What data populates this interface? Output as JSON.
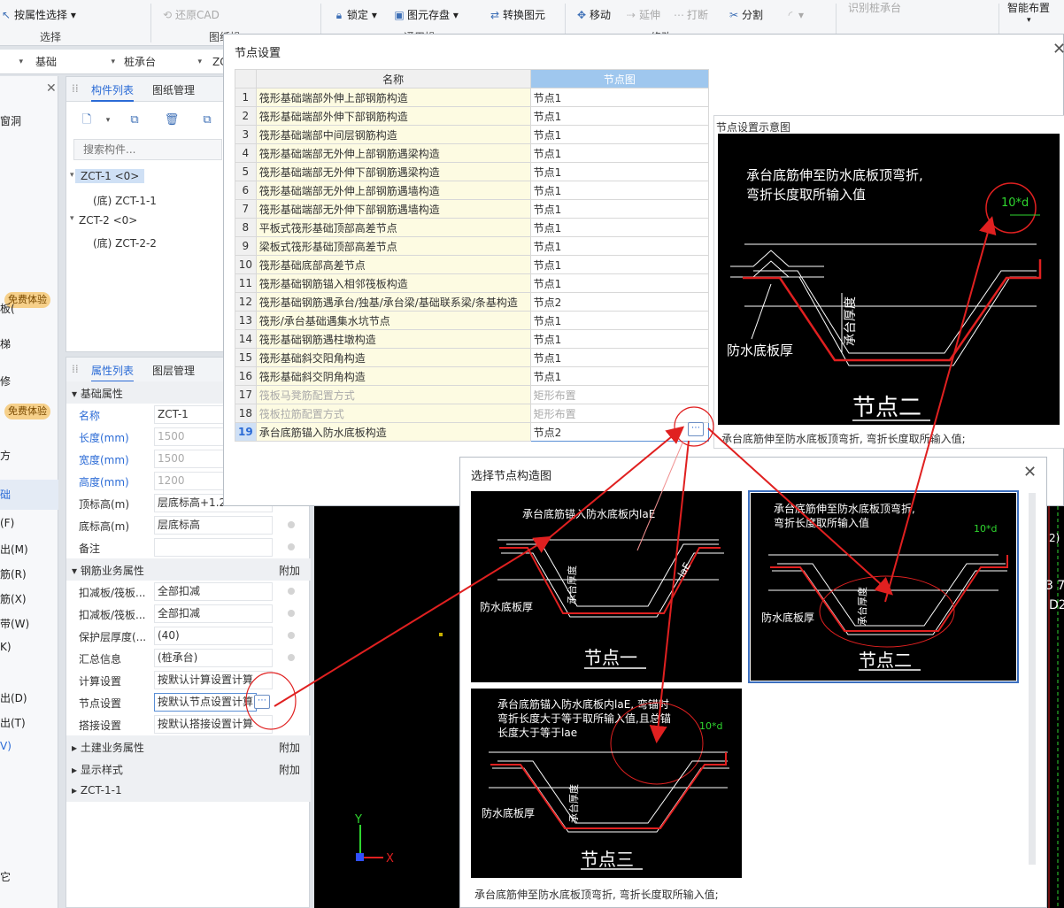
{
  "ribbon": {
    "select_by_attr": "按属性选择",
    "restore_cad": "还原CAD",
    "lock": "锁定",
    "save_element": "图元存盘",
    "convert_element": "转换图元",
    "move": "移动",
    "extend": "延伸",
    "break": "打断",
    "split": "分割",
    "identify_pile_cap": "识别桩承台",
    "smart_layout": "智能布置",
    "group_select": "选择",
    "group_drawing": "图纸操",
    "group_general": "通用操",
    "group_modify": "修改"
  },
  "selectors": {
    "floor": "",
    "category": "基础",
    "type": "桩承台",
    "comp": "ZC"
  },
  "left_strip": {
    "items": [
      "窗洞",
      "板(",
      "梯",
      "修",
      "方",
      "础",
      "(F)",
      "出(M)",
      "筋(R)",
      "筋(X)",
      "带(W)",
      "K)",
      "出(D)",
      "出(T)",
      "V)",
      "它"
    ],
    "badge": "免费体验"
  },
  "component_list": {
    "tab_active": "构件列表",
    "tab_other": "图纸管理",
    "search_placeholder": "搜索构件...",
    "tree": [
      "ZCT-1 <0>",
      "(底) ZCT-1-1",
      "ZCT-2 <0>",
      "(底) ZCT-2-2"
    ]
  },
  "property_panel": {
    "tab_active": "属性列表",
    "tab_other": "图层管理",
    "groups": {
      "basic": "基础属性",
      "rebar": "钢筋业务属性",
      "civil": "土建业务属性",
      "display": "显示样式",
      "sub": "ZCT-1-1"
    },
    "extra": "附加",
    "rows": [
      {
        "label": "名称",
        "value": "ZCT-1"
      },
      {
        "label": "长度(mm)",
        "value": "1500"
      },
      {
        "label": "宽度(mm)",
        "value": "1500"
      },
      {
        "label": "高度(mm)",
        "value": "1200"
      },
      {
        "label": "顶标高(m)",
        "value": "层底标高+1.2"
      },
      {
        "label": "底标高(m)",
        "value": "层底标高"
      },
      {
        "label": "备注",
        "value": ""
      },
      {
        "label": "扣减板/筏板...",
        "value": "全部扣减"
      },
      {
        "label": "扣减板/筏板...",
        "value": "全部扣减"
      },
      {
        "label": "保护层厚度(...",
        "value": "(40)"
      },
      {
        "label": "汇总信息",
        "value": "(桩承台)"
      },
      {
        "label": "计算设置",
        "value": "按默认计算设置计算"
      },
      {
        "label": "节点设置",
        "value": "按默认节点设置计算"
      },
      {
        "label": "搭接设置",
        "value": "按默认搭接设置计算"
      }
    ]
  },
  "node_dialog": {
    "title": "节点设置",
    "col_name": "名称",
    "col_node": "节点图",
    "rows": [
      {
        "no": "1",
        "name": "筏形基础端部外伸上部钢筋构造",
        "node": "节点1"
      },
      {
        "no": "2",
        "name": "筏形基础端部外伸下部钢筋构造",
        "node": "节点1"
      },
      {
        "no": "3",
        "name": "筏形基础端部中间层钢筋构造",
        "node": "节点1"
      },
      {
        "no": "4",
        "name": "筏形基础端部无外伸上部钢筋遇梁构造",
        "node": "节点1"
      },
      {
        "no": "5",
        "name": "筏形基础端部无外伸下部钢筋遇梁构造",
        "node": "节点1"
      },
      {
        "no": "6",
        "name": "筏形基础端部无外伸上部钢筋遇墙构造",
        "node": "节点1"
      },
      {
        "no": "7",
        "name": "筏形基础端部无外伸下部钢筋遇墙构造",
        "node": "节点1"
      },
      {
        "no": "8",
        "name": "平板式筏形基础顶部高差节点",
        "node": "节点1"
      },
      {
        "no": "9",
        "name": "梁板式筏形基础顶部高差节点",
        "node": "节点1"
      },
      {
        "no": "10",
        "name": "筏形基础底部高差节点",
        "node": "节点1"
      },
      {
        "no": "11",
        "name": "筏形基础钢筋锚入相邻筏板构造",
        "node": "节点1"
      },
      {
        "no": "12",
        "name": "筏形基础钢筋遇承台/独基/承台梁/基础联系梁/条基构造",
        "node": "节点2"
      },
      {
        "no": "13",
        "name": "筏形/承台基础遇集水坑节点",
        "node": "节点1"
      },
      {
        "no": "14",
        "name": "筏形基础钢筋遇柱墩构造",
        "node": "节点1"
      },
      {
        "no": "15",
        "name": "筏形基础斜交阳角构造",
        "node": "节点1"
      },
      {
        "no": "16",
        "name": "筏形基础斜交阴角构造",
        "node": "节点1"
      },
      {
        "no": "17",
        "name": "筏板马凳筋配置方式",
        "node": "矩形布置"
      },
      {
        "no": "18",
        "name": "筏板拉筋配置方式",
        "node": "矩形布置"
      },
      {
        "no": "19",
        "name": "承台底筋锚入防水底板构造",
        "node": "节点2"
      }
    ],
    "preview_label": "节点设置示意图",
    "preview_text1": "承台底筋伸至防水底板顶弯折,",
    "preview_text2": "弯折长度取所输入值",
    "preview_dim": "10*d",
    "preview_thickness": "承台厚度",
    "preview_waterproof": "防水底板厚",
    "preview_title": "节点二",
    "preview_caption": "承台底筋伸至防水底板顶弯折, 弯折长度取所输入值;"
  },
  "choose_dialog": {
    "title": "选择节点构造图",
    "node1": {
      "text": "承台底筋锚入防水底板内laE",
      "dim": "laE",
      "title": "节点一"
    },
    "node2": {
      "text1": "承台底筋伸至防水底板顶弯折,",
      "text2": "弯折长度取所输入值",
      "dim": "10*d",
      "title": "节点二"
    },
    "node3": {
      "text1": "承台底筋锚入防水底板内laE, 弯锚时",
      "text2": "弯折长度大于等于取所输入值,且总锚",
      "text3": "长度大于等于lae",
      "dim": "10*d",
      "title": "节点三"
    },
    "thickness": "承台厚度",
    "waterproof": "防水底板厚",
    "caption": "承台底筋伸至防水底板顶弯折, 弯折长度取所输入值;"
  },
  "canvas": {
    "axis_x": "X",
    "axis_y": "Y",
    "right_labels": [
      "2)",
      "3 7",
      "D2"
    ]
  }
}
